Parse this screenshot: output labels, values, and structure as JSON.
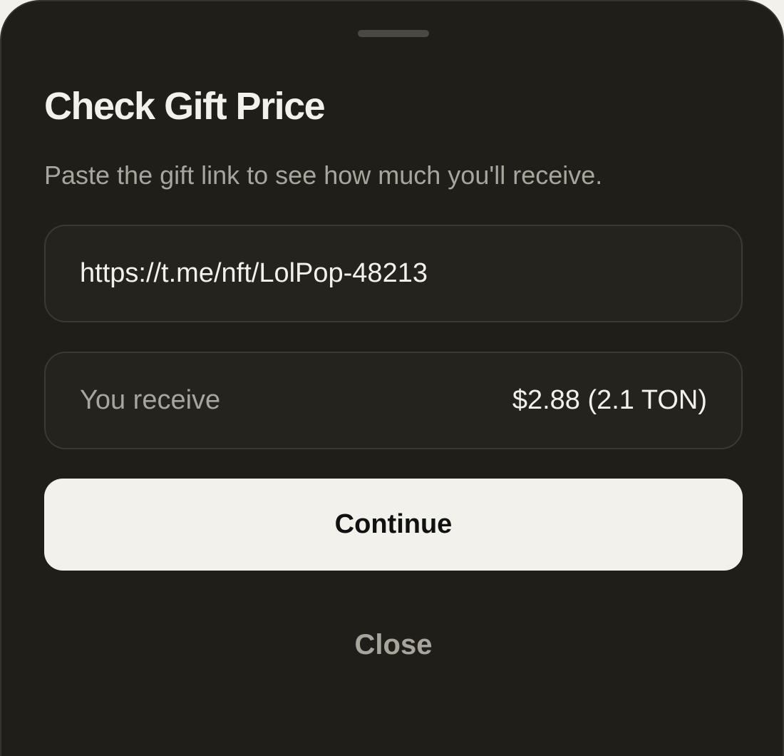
{
  "sheet": {
    "title": "Check Gift Price",
    "subtitle": "Paste the gift link to see how much you'll receive."
  },
  "link_field": {
    "value": "https://t.me/nft/LolPop-48213",
    "placeholder": ""
  },
  "receive": {
    "label": "You receive",
    "value": "$2.88 (2.1 TON)"
  },
  "buttons": {
    "continue_label": "Continue",
    "close_label": "Close"
  },
  "colors": {
    "sheet_background": "#1f1e19",
    "field_background": "#24231e",
    "primary_button": "#f3f1eb",
    "muted_text": "#a8a59c"
  }
}
